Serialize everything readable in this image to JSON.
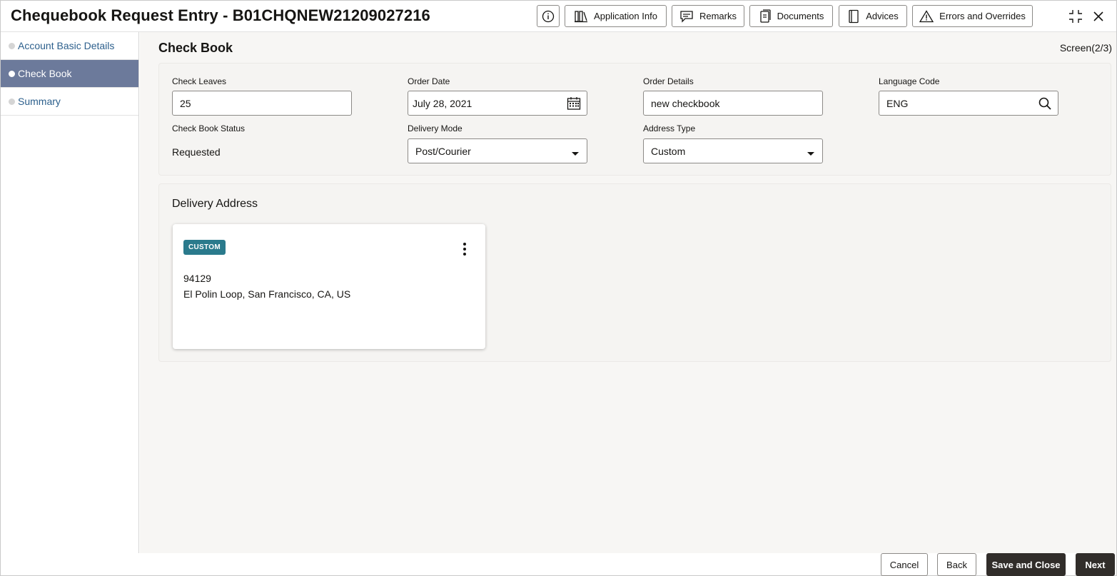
{
  "header": {
    "title": "Chequebook Request Entry - B01CHQNEW21209027216",
    "buttons": {
      "application_info": "Application Info",
      "remarks": "Remarks",
      "documents": "Documents",
      "advices": "Advices",
      "errors": "Errors and Overrides"
    }
  },
  "sidebar": {
    "items": [
      {
        "label": "Account Basic Details",
        "active": false
      },
      {
        "label": "Check Book",
        "active": true
      },
      {
        "label": "Summary",
        "active": false
      }
    ]
  },
  "main": {
    "section_title": "Check Book",
    "screen_indicator": "Screen(2/3)",
    "form": {
      "check_leaves": {
        "label": "Check Leaves",
        "value": "25"
      },
      "order_date": {
        "label": "Order Date",
        "value": "July 28, 2021"
      },
      "order_details": {
        "label": "Order Details",
        "value": "new checkbook"
      },
      "language_code": {
        "label": "Language Code",
        "value": "ENG"
      },
      "check_book_status": {
        "label": "Check Book Status",
        "value": "Requested"
      },
      "delivery_mode": {
        "label": "Delivery Mode",
        "value": "Post/Courier"
      },
      "address_type": {
        "label": "Address Type",
        "value": "Custom"
      }
    },
    "delivery_address": {
      "title": "Delivery Address",
      "card": {
        "badge": "CUSTOM",
        "line1": "94129",
        "line2": "El Polin Loop, San Francisco, CA, US"
      }
    }
  },
  "footer": {
    "cancel": "Cancel",
    "back": "Back",
    "save_close": "Save and Close",
    "next": "Next"
  },
  "colors": {
    "active_nav_bg": "#6c7a9b",
    "badge_bg": "#2a7a8c",
    "primary_button_bg": "#312d2a",
    "link_color": "#2c5f8c"
  }
}
